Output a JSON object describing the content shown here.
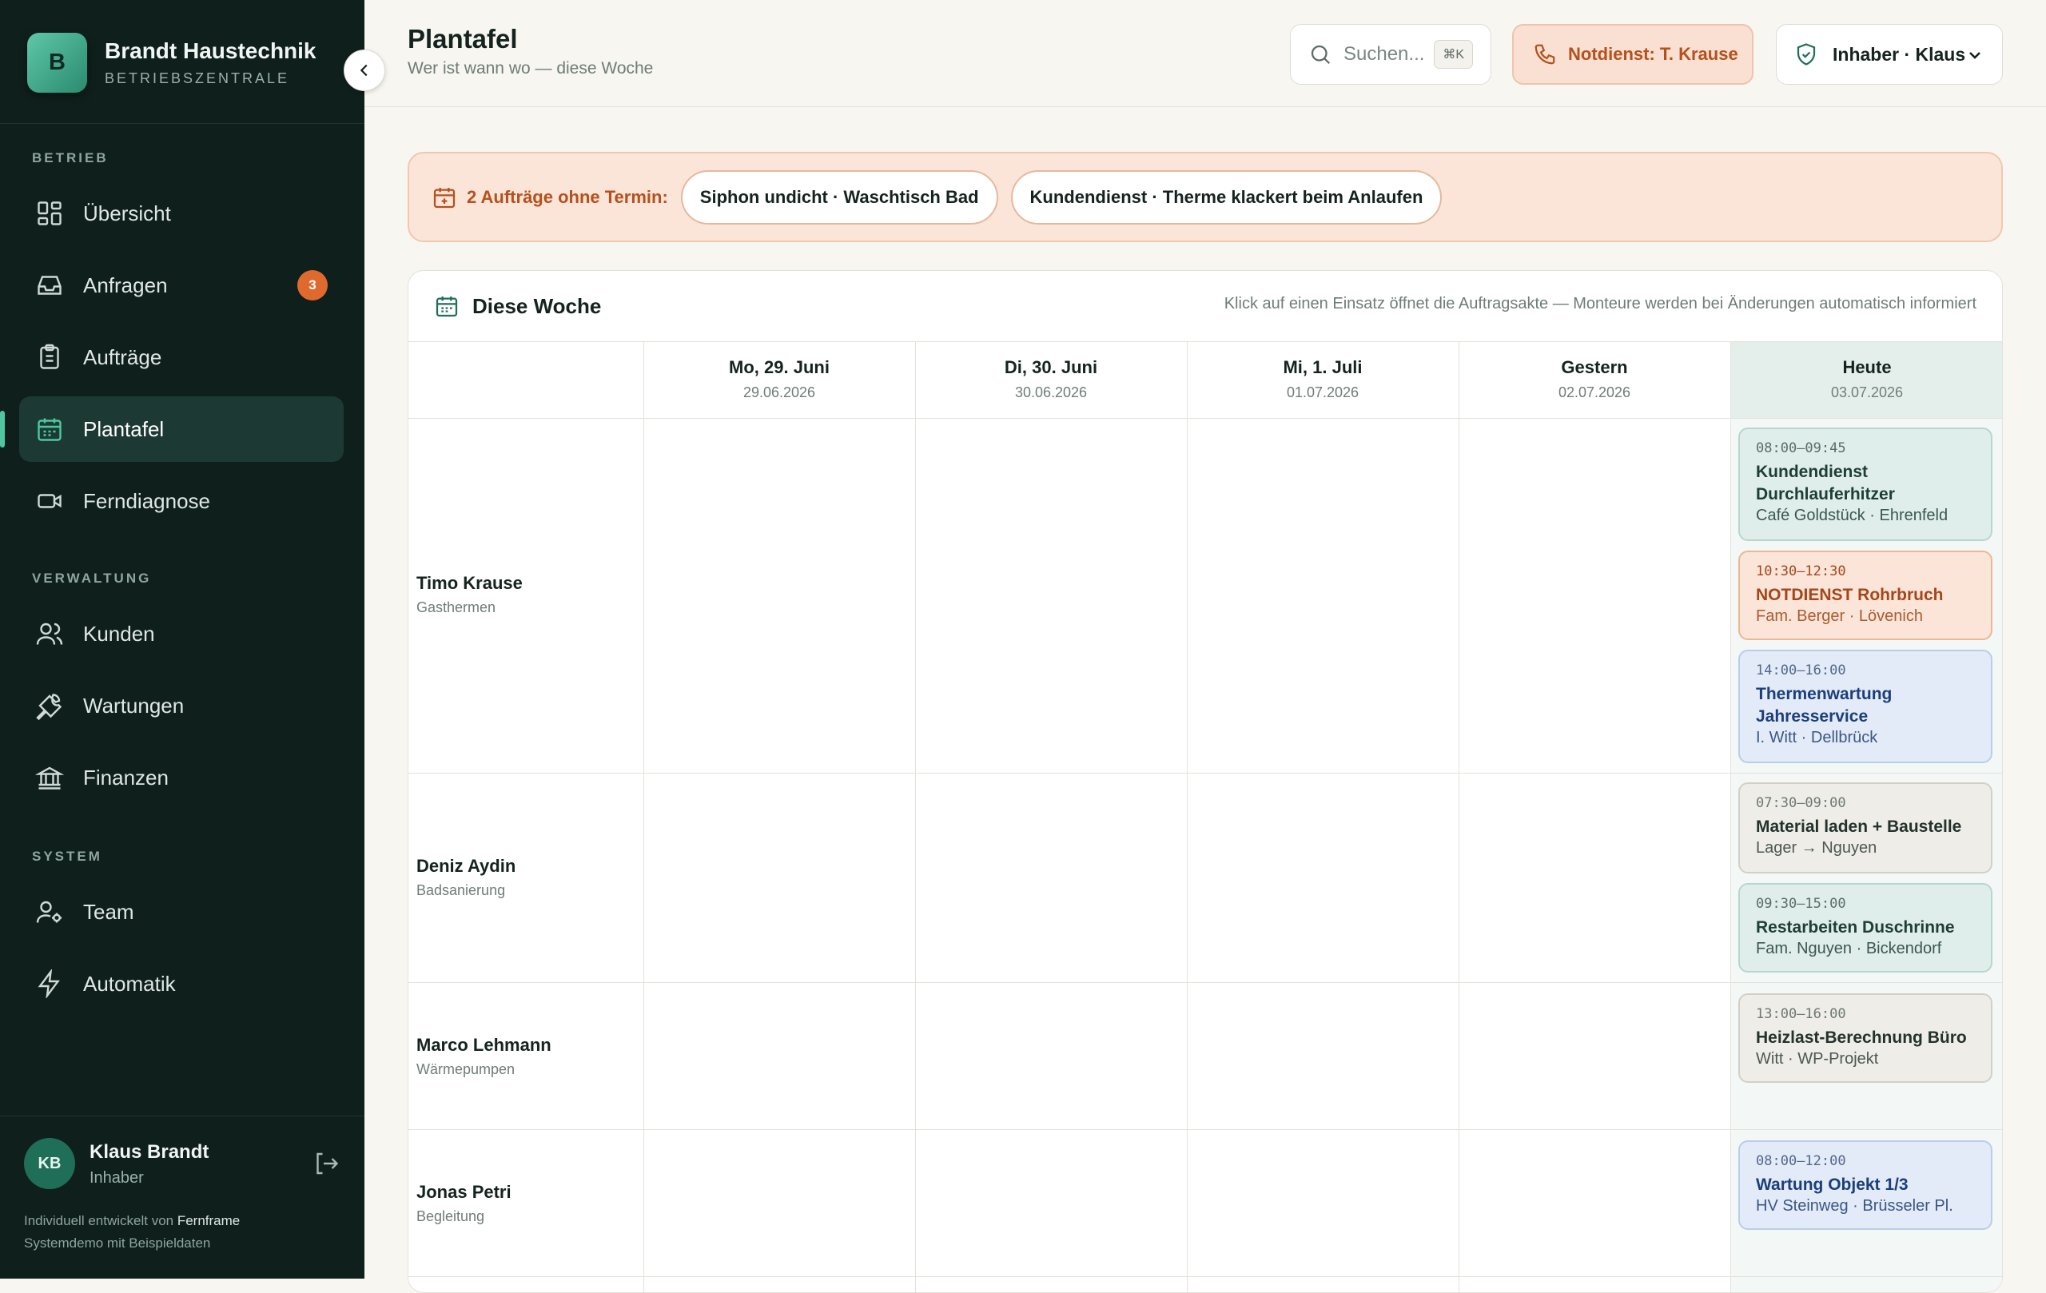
{
  "sidebar": {
    "brand": {
      "logo_letter": "B",
      "name": "Brandt Haustechnik",
      "subtitle": "BETRIEBSZENTRALE"
    },
    "sections": [
      "BETRIEB",
      "VERWALTUNG",
      "SYSTEM"
    ],
    "items": [
      {
        "label": "Übersicht",
        "icon": "dashboard-grid-icon"
      },
      {
        "label": "Anfragen",
        "icon": "inbox-icon",
        "badge": "3"
      },
      {
        "label": "Aufträge",
        "icon": "clipboard-icon"
      },
      {
        "label": "Plantafel",
        "icon": "calendar-icon",
        "active": true
      },
      {
        "label": "Ferndiagnose",
        "icon": "video-camera-icon"
      },
      {
        "label": "Kunden",
        "icon": "users-icon"
      },
      {
        "label": "Wartungen",
        "icon": "wrench-icon"
      },
      {
        "label": "Finanzen",
        "icon": "bank-icon"
      },
      {
        "label": "Team",
        "icon": "user-gear-icon"
      },
      {
        "label": "Automatik",
        "icon": "lightning-icon"
      }
    ],
    "user": {
      "initials": "KB",
      "name": "Klaus Brandt",
      "role": "Inhaber"
    },
    "credit": {
      "prefix": "Individuell entwickelt von",
      "company": "Fernframe",
      "line2": "Systemdemo mit Beispieldaten"
    }
  },
  "header": {
    "title": "Plantafel",
    "subtitle": "Wer ist wann wo — diese Woche",
    "search_placeholder": "Suchen...",
    "search_shortcut": "⌘K",
    "emergency": "Notdienst: T. Krause",
    "role": "Inhaber · Klaus"
  },
  "banner": {
    "label": "2 Aufträge ohne Termin:",
    "chips": [
      "Siphon undicht · Waschtisch Bad",
      "Kundendienst · Therme klackert beim Anlaufen"
    ]
  },
  "board": {
    "title": "Diese Woche",
    "hint": "Klick auf einen Einsatz öffnet die Auftragsakte — Monteure werden bei Änderungen automatisch informiert",
    "days": [
      {
        "name": "Mo, 29. Juni",
        "date": "29.06.2026"
      },
      {
        "name": "Di, 30. Juni",
        "date": "30.06.2026"
      },
      {
        "name": "Mi, 1. Juli",
        "date": "01.07.2026"
      },
      {
        "name": "Gestern",
        "date": "02.07.2026"
      },
      {
        "name": "Heute",
        "date": "03.07.2026"
      }
    ],
    "rows": [
      {
        "name": "Timo Krause",
        "skill": "Gasthermen"
      },
      {
        "name": "Deniz Aydin",
        "skill": "Badsanierung"
      },
      {
        "name": "Marco Lehmann",
        "skill": "Wärmepumpen"
      },
      {
        "name": "Jonas Petri",
        "skill": "Begleitung"
      }
    ],
    "events": [
      {
        "time": "08:00–09:45",
        "title": "Kundendienst Durchlauferhitzer",
        "location": "Café Goldstück · Ehrenfeld",
        "style": "teal"
      },
      {
        "time": "10:30–12:30",
        "title": "NOTDIENST Rohrbruch",
        "location": "Fam. Berger · Lövenich",
        "style": "orange"
      },
      {
        "time": "14:00–16:00",
        "title": "Thermenwartung Jahresservice",
        "location": "I. Witt · Dellbrück",
        "style": "blue"
      },
      {
        "time": "07:30–09:00",
        "title": "Material laden + Baustelle",
        "location": "Lager → Nguyen",
        "style": "gray"
      },
      {
        "time": "09:30–15:00",
        "title": "Restarbeiten Duschrinne",
        "location": "Fam. Nguyen · Bickendorf",
        "style": "teal"
      },
      {
        "time": "13:00–16:00",
        "title": "Heizlast-Berechnung Büro",
        "location": "Witt · WP-Projekt",
        "style": "gray"
      },
      {
        "time": "08:00–12:00",
        "title": "Wartung Objekt 1/3",
        "location": "HV Steinweg · Brüsseler Pl.",
        "style": "blue"
      }
    ]
  },
  "colors": {
    "sidebar_bg": "#0f1f1b",
    "accent_teal": "#4fc8a1",
    "badge_orange": "#e0692e",
    "emergency_text": "#b4511c"
  }
}
